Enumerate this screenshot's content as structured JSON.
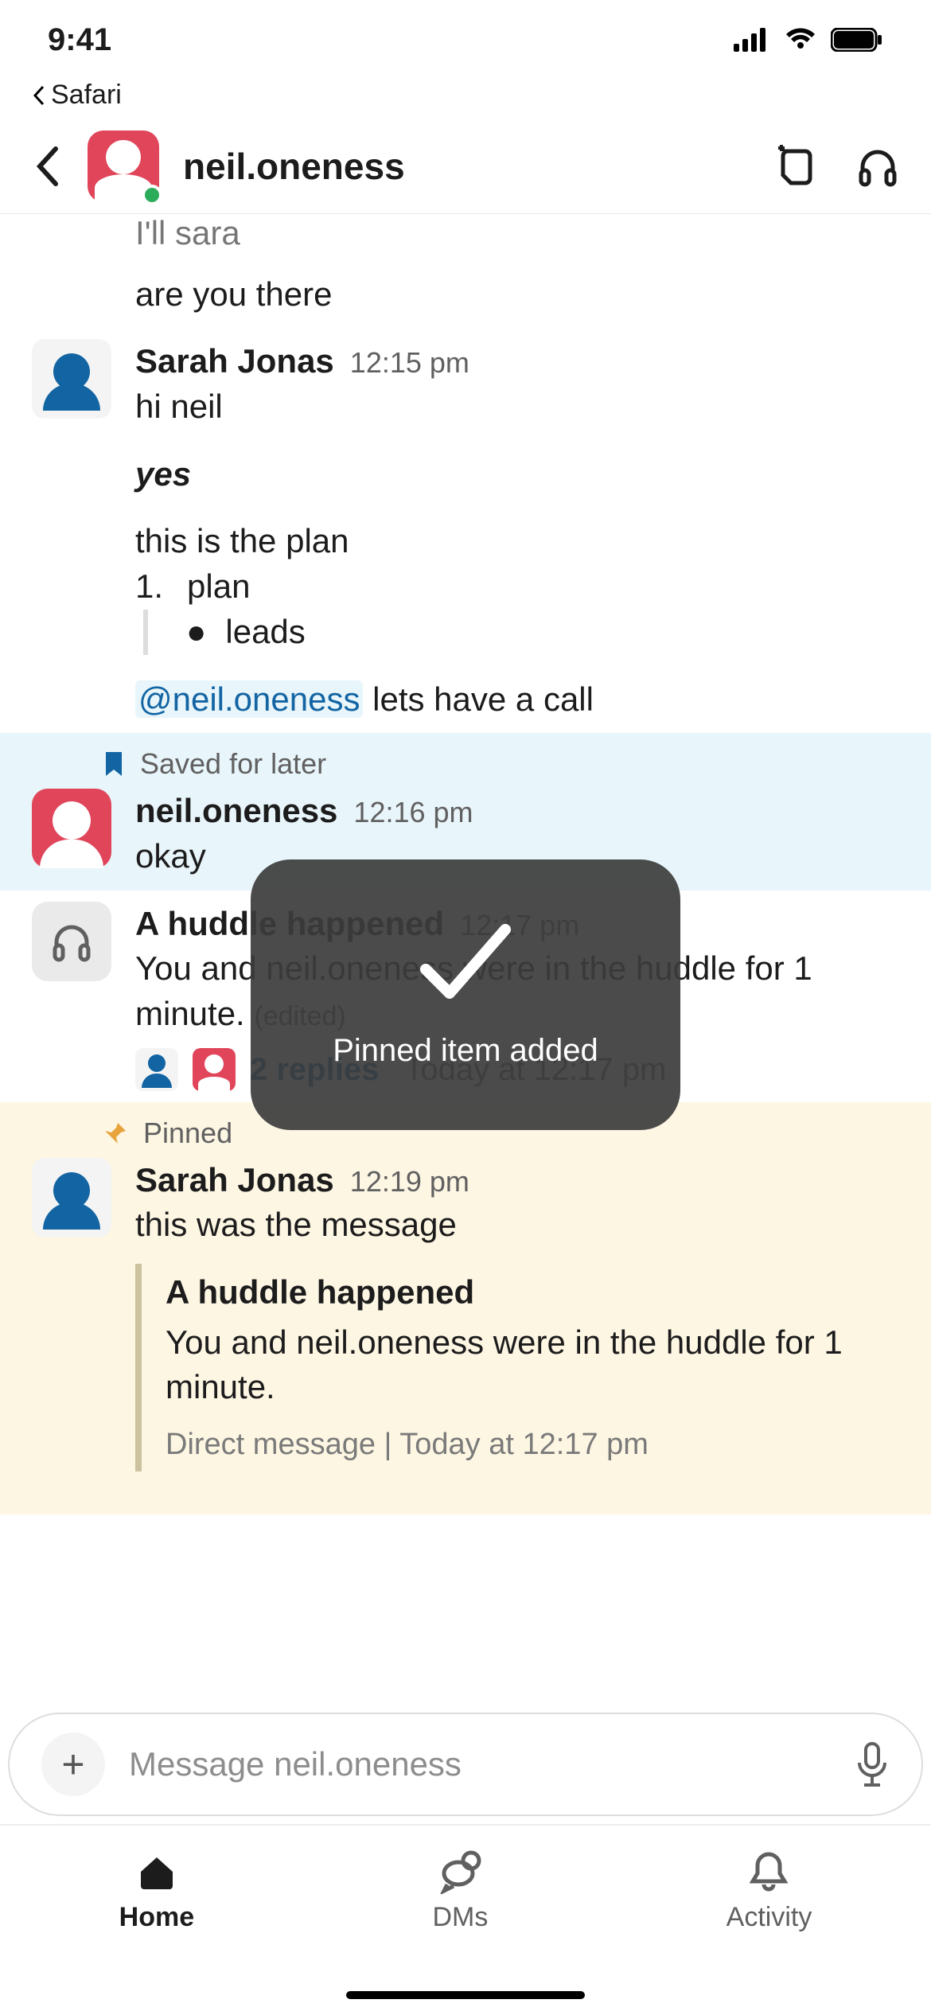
{
  "status": {
    "time": "9:41",
    "back_app": "Safari"
  },
  "header": {
    "title": "neil.oneness"
  },
  "messages": {
    "top_partial": "I'll sara",
    "top_q": "are you there",
    "sarah1": {
      "name": "Sarah Jonas",
      "time": "12:15 pm",
      "line1": "hi neil",
      "yes": "yes",
      "plan_intro": "this is the plan",
      "ol_num": "1.",
      "ol_item": "plan",
      "ul_item": "leads",
      "mention": "@neil.oneness",
      "mention_rest": " lets have a call"
    },
    "saved_label": "Saved for later",
    "neil": {
      "name": "neil.oneness",
      "time": "12:16 pm",
      "text": "okay"
    },
    "huddle": {
      "title": "A huddle happened",
      "time": "12:17 pm",
      "body": "You and neil.oneness were in the huddle for 1 minute.",
      "edited": "(edited)",
      "replies": "2 replies",
      "replies_ts": "Today at 12:17 pm"
    },
    "pinned_label": "Pinned",
    "sarah2": {
      "name": "Sarah Jonas",
      "time": "12:19 pm",
      "text": "this was the message",
      "q_title": "A huddle happened",
      "q_body": "You and neil.oneness were in the huddle for 1 minute.",
      "q_meta": "Direct message | Today at 12:17 pm"
    }
  },
  "composer": {
    "placeholder": "Message neil.oneness"
  },
  "tabs": {
    "home": "Home",
    "dms": "DMs",
    "activity": "Activity"
  },
  "toast": {
    "text": "Pinned item added"
  }
}
